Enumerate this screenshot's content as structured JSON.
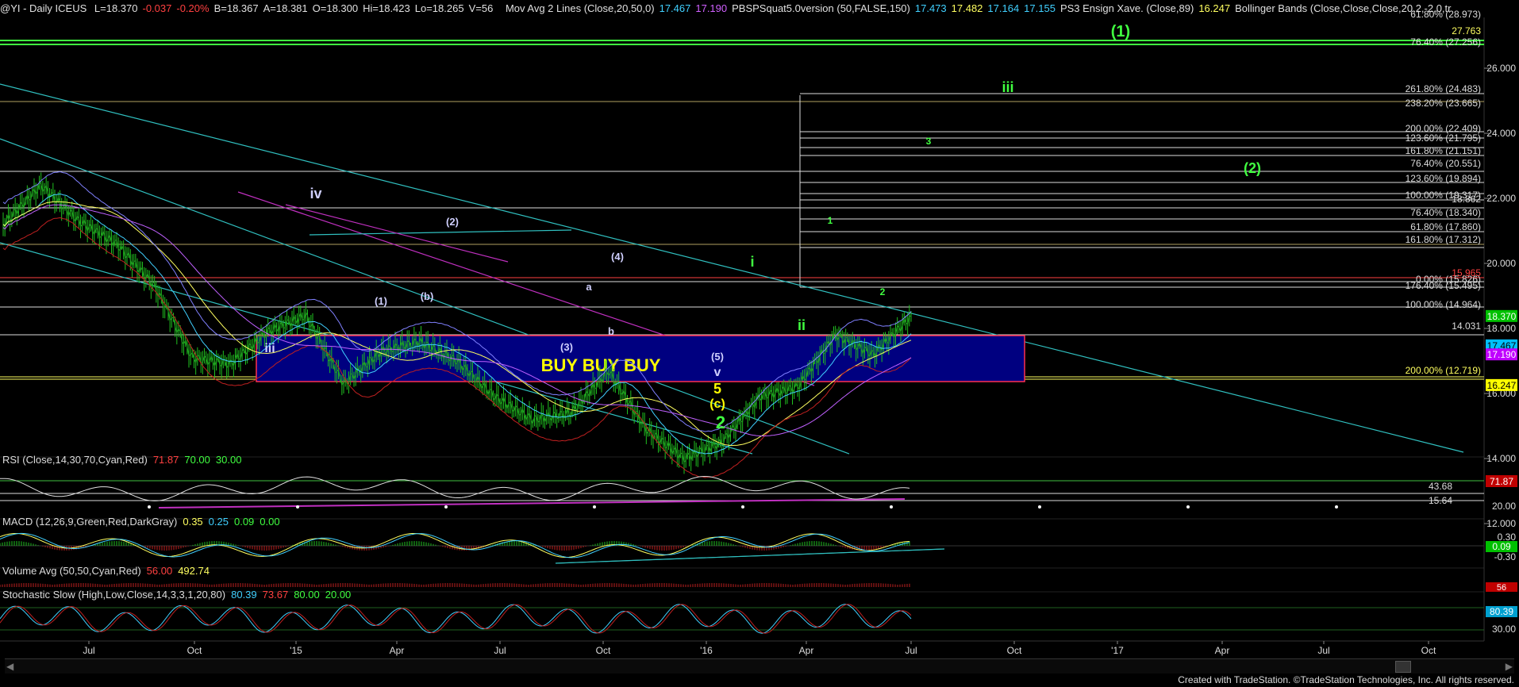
{
  "header": {
    "symbol": "@YI - Daily  ICEUS",
    "quote": [
      {
        "t": "L=18.370",
        "c": "#e0e0e0"
      },
      {
        "t": "-0.037",
        "c": "#ff4040"
      },
      {
        "t": "-0.20%",
        "c": "#ff4040"
      },
      {
        "t": "B=18.367",
        "c": "#e0e0e0"
      },
      {
        "t": "A=18.381",
        "c": "#e0e0e0"
      },
      {
        "t": "O=18.300",
        "c": "#e0e0e0"
      },
      {
        "t": "Hi=18.423",
        "c": "#e0e0e0"
      },
      {
        "t": "Lo=18.265",
        "c": "#e0e0e0"
      },
      {
        "t": "V=56",
        "c": "#e0e0e0"
      }
    ],
    "studies": [
      {
        "t": "Mov Avg 2 Lines (Close,20,50,0)",
        "c": "#e0e0e0"
      },
      {
        "t": "17.467",
        "c": "#40d0ff"
      },
      {
        "t": "17.190",
        "c": "#d060ff"
      },
      {
        "t": "PBSPSquat5.0version (50,FALSE,150)",
        "c": "#e0e0e0"
      },
      {
        "t": "17.473",
        "c": "#40d0ff"
      },
      {
        "t": "17.482",
        "c": "#ffff60"
      },
      {
        "t": "17.164",
        "c": "#40d0ff"
      },
      {
        "t": "17.155",
        "c": "#40d0ff"
      },
      {
        "t": "PS3 Ensign Xave. (Close,89)",
        "c": "#e0e0e0"
      },
      {
        "t": "16.247",
        "c": "#ffff60"
      },
      {
        "t": "Bollinger Bands (Close,Close,Close,20,2,-2,0,tr",
        "c": "#e0e0e0"
      }
    ]
  },
  "price_axis": {
    "ticks": [
      "26.000",
      "24.000",
      "22.000",
      "20.000",
      "18.000",
      "16.000",
      "14.000",
      "12.000"
    ],
    "markers": [
      {
        "label": "18.370",
        "bg": "#00c000",
        "fg": "#ffffff"
      },
      {
        "label": "17.467",
        "bg": "#00c0ff",
        "fg": "#000000"
      },
      {
        "label": "17.190",
        "bg": "#c000ff",
        "fg": "#ffffff"
      },
      {
        "label": "16.247",
        "bg": "#ffff00",
        "fg": "#000000"
      }
    ]
  },
  "fib_labels": [
    "61.80% (28.973)",
    "76.40% (27.256)",
    "261.80% (24.483)",
    "238.20% (23.665)",
    "200.00% (22.409)",
    "123.60% (21.795)",
    "161.80% (21.151)",
    "76.40% (20.551)",
    "123.60% (19.894)",
    "100.00% (19.317)",
    "18.862",
    "76.40% (18.340)",
    "61.80% (17.860)",
    "161.80% (17.312)",
    "15.965",
    "0.00% (15.826)",
    "176.40% (15.495)",
    "100.00% (14.964)",
    "14.031",
    "200.00% (12.719)",
    "27.763"
  ],
  "wave_labels": [
    {
      "t": "(1)",
      "c": "#40ff40"
    },
    {
      "t": "iii",
      "c": "#40ff40"
    },
    {
      "t": "3",
      "c": "#40ff40"
    },
    {
      "t": "(2)",
      "c": "#40ff40"
    },
    {
      "t": "iv",
      "c": "#d0d0ff"
    },
    {
      "t": "(2)",
      "c": "#d0d0ff"
    },
    {
      "t": "(4)",
      "c": "#d0d0ff"
    },
    {
      "t": "i",
      "c": "#40ff40"
    },
    {
      "t": "1",
      "c": "#40ff40"
    },
    {
      "t": "(1)",
      "c": "#d0d0ff"
    },
    {
      "t": "(b)",
      "c": "#d0d0ff"
    },
    {
      "t": "a",
      "c": "#d0d0ff"
    },
    {
      "t": "b",
      "c": "#d0d0ff"
    },
    {
      "t": "(3)",
      "c": "#d0d0ff"
    },
    {
      "t": "ii",
      "c": "#40ff40"
    },
    {
      "t": "2",
      "c": "#40ff40"
    },
    {
      "t": "iii",
      "c": "#d0d0ff"
    },
    {
      "t": "(5)",
      "c": "#d0d0ff"
    },
    {
      "t": "v",
      "c": "#d0d0ff"
    },
    {
      "t": "5",
      "c": "#ffff00"
    },
    {
      "t": "(c)",
      "c": "#ffff00"
    },
    {
      "t": "2",
      "c": "#40ff40"
    }
  ],
  "buy_box_text": "BUY BUY BUY",
  "rsi": {
    "title": "RSI (Close,14,30,70,Cyan,Red)",
    "values": [
      {
        "t": "71.87",
        "c": "#ff4040"
      },
      {
        "t": "70.00",
        "c": "#40ff40"
      },
      {
        "t": "30.00",
        "c": "#40ff40"
      }
    ],
    "levels": [
      "43.68",
      "15.64"
    ],
    "tick": "20.00",
    "marker": "71.87"
  },
  "macd": {
    "title": "MACD (12,26,9,Green,Red,DarkGray)",
    "values": [
      {
        "t": "0.35",
        "c": "#ffff60"
      },
      {
        "t": "0.25",
        "c": "#40d0ff"
      },
      {
        "t": "0.09",
        "c": "#40ff40"
      },
      {
        "t": "0.00",
        "c": "#40ff40"
      }
    ],
    "ticks": [
      "0.30",
      "-0.30"
    ],
    "marker": "0.09"
  },
  "volume": {
    "title": "Volume Avg (50,50,Cyan,Red)",
    "values": [
      {
        "t": "56.00",
        "c": "#ff4040"
      },
      {
        "t": "492.74",
        "c": "#ffff60"
      }
    ],
    "marker": "56"
  },
  "stoch": {
    "title": "Stochastic Slow (High,Low,Close,14,3,3,1,20,80)",
    "values": [
      {
        "t": "80.39",
        "c": "#40d0ff"
      },
      {
        "t": "73.67",
        "c": "#ff4040"
      },
      {
        "t": "80.00",
        "c": "#40ff40"
      },
      {
        "t": "20.00",
        "c": "#40ff40"
      }
    ],
    "ticks": [
      "30.00"
    ],
    "marker": "80.39"
  },
  "time_axis": [
    "Jul",
    "Oct",
    "'15",
    "Apr",
    "Jul",
    "Oct",
    "'16",
    "Apr",
    "Jul",
    "Oct",
    "'17",
    "Apr",
    "Jul",
    "Oct"
  ],
  "footer": "Created with TradeStation. ©TradeStation Technologies, Inc. All rights reserved.",
  "chart_data": {
    "type": "line",
    "description_series": "close",
    "ylim": [
      10.5,
      29.0
    ],
    "series": [
      {
        "name": "close",
        "x": [
          "2014-06",
          "2014-07",
          "2014-08",
          "2014-09",
          "2014-10",
          "2014-11",
          "2014-12",
          "2015-01",
          "2015-02",
          "2015-03",
          "2015-04",
          "2015-05",
          "2015-06",
          "2015-07",
          "2015-08",
          "2015-09",
          "2015-10",
          "2015-11",
          "2015-12",
          "2016-01",
          "2016-02",
          "2016-03",
          "2016-04",
          "2016-05",
          "2016-06"
        ],
        "values": [
          21.2,
          22.4,
          21.3,
          20.6,
          19.3,
          17.1,
          16.9,
          17.9,
          18.4,
          16.3,
          17.3,
          17.6,
          17.0,
          15.9,
          15.2,
          15.4,
          16.7,
          14.9,
          14.0,
          14.5,
          15.9,
          16.2,
          17.8,
          17.2,
          18.37
        ]
      }
    ]
  }
}
